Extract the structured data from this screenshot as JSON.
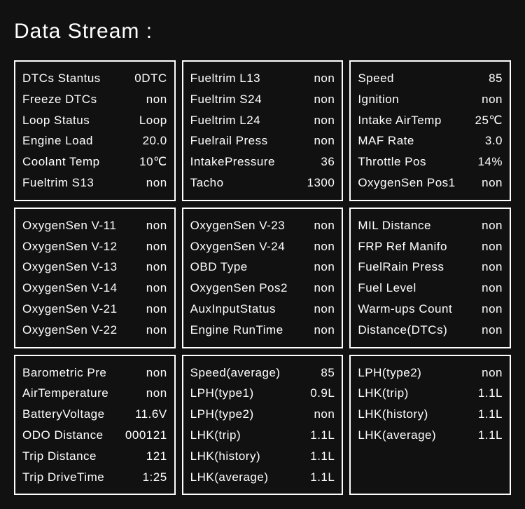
{
  "title": "Data Stream :",
  "panels": [
    {
      "rows": [
        {
          "label": "DTCs  Stantus",
          "value": "0DTC"
        },
        {
          "label": "Freeze DTCs",
          "value": "non"
        },
        {
          "label": "Loop  Status",
          "value": "Loop"
        },
        {
          "label": "Engine Load",
          "value": "20.0"
        },
        {
          "label": "Coolant  Temp",
          "value": "10℃"
        },
        {
          "label": "Fueltrim S13",
          "value": "non"
        }
      ]
    },
    {
      "rows": [
        {
          "label": "Fueltrim L13",
          "value": "non"
        },
        {
          "label": "Fueltrim S24",
          "value": "non"
        },
        {
          "label": "Fueltrim L24",
          "value": "non"
        },
        {
          "label": "Fuelrail Press",
          "value": "non"
        },
        {
          "label": "IntakePressure",
          "value": "36"
        },
        {
          "label": "Tacho",
          "value": "1300"
        }
      ]
    },
    {
      "rows": [
        {
          "label": "Speed",
          "value": "85"
        },
        {
          "label": "Ignition",
          "value": "non"
        },
        {
          "label": "Intake AirTemp",
          "value": "25℃"
        },
        {
          "label": "MAF Rate",
          "value": "3.0"
        },
        {
          "label": "Throttle Pos",
          "value": "14%"
        },
        {
          "label": "OxygenSen Pos1",
          "value": "non"
        }
      ]
    },
    {
      "rows": [
        {
          "label": "OxygenSen V-11",
          "value": "non"
        },
        {
          "label": "OxygenSen V-12",
          "value": "non"
        },
        {
          "label": "OxygenSen V-13",
          "value": "non"
        },
        {
          "label": "OxygenSen V-14",
          "value": "non"
        },
        {
          "label": "OxygenSen V-21",
          "value": "non"
        },
        {
          "label": "OxygenSen V-22",
          "value": "non"
        }
      ]
    },
    {
      "rows": [
        {
          "label": "OxygenSen V-23",
          "value": "non"
        },
        {
          "label": "OxygenSen V-24",
          "value": "non"
        },
        {
          "label": "OBD Type",
          "value": "non"
        },
        {
          "label": "OxygenSen Pos2",
          "value": "non"
        },
        {
          "label": "AuxInputStatus",
          "value": "non"
        },
        {
          "label": "Engine RunTime",
          "value": "non"
        }
      ]
    },
    {
      "rows": [
        {
          "label": "MIL  Distance",
          "value": "non"
        },
        {
          "label": "FRP Ref Manifo",
          "value": "non"
        },
        {
          "label": "FuelRain Press",
          "value": "non"
        },
        {
          "label": "Fuel Level",
          "value": "non"
        },
        {
          "label": "Warm-ups Count",
          "value": "non"
        },
        {
          "label": "Distance(DTCs)",
          "value": "non"
        }
      ]
    },
    {
      "rows": [
        {
          "label": "Barometric Pre",
          "value": "non"
        },
        {
          "label": "AirTemperature",
          "value": "non"
        },
        {
          "label": "BatteryVoltage",
          "value": "11.6V"
        },
        {
          "label": "ODO Distance",
          "value": "000121"
        },
        {
          "label": "Trip Distance",
          "value": "121"
        },
        {
          "label": "Trip DriveTime",
          "value": "1:25"
        }
      ]
    },
    {
      "rows": [
        {
          "label": "Speed(average)",
          "value": "85"
        },
        {
          "label": "LPH(type1)",
          "value": "0.9L"
        },
        {
          "label": "LPH(type2)",
          "value": "non"
        },
        {
          "label": "LHK(trip)",
          "value": "1.1L"
        },
        {
          "label": "LHK(history)",
          "value": "1.1L"
        },
        {
          "label": "LHK(average)",
          "value": "1.1L"
        }
      ]
    },
    {
      "rows": [
        {
          "label": "LPH(type2)",
          "value": "non"
        },
        {
          "label": "LHK(trip)",
          "value": "1.1L"
        },
        {
          "label": "LHK(history)",
          "value": "1.1L"
        },
        {
          "label": "LHK(average)",
          "value": "1.1L"
        }
      ]
    }
  ]
}
